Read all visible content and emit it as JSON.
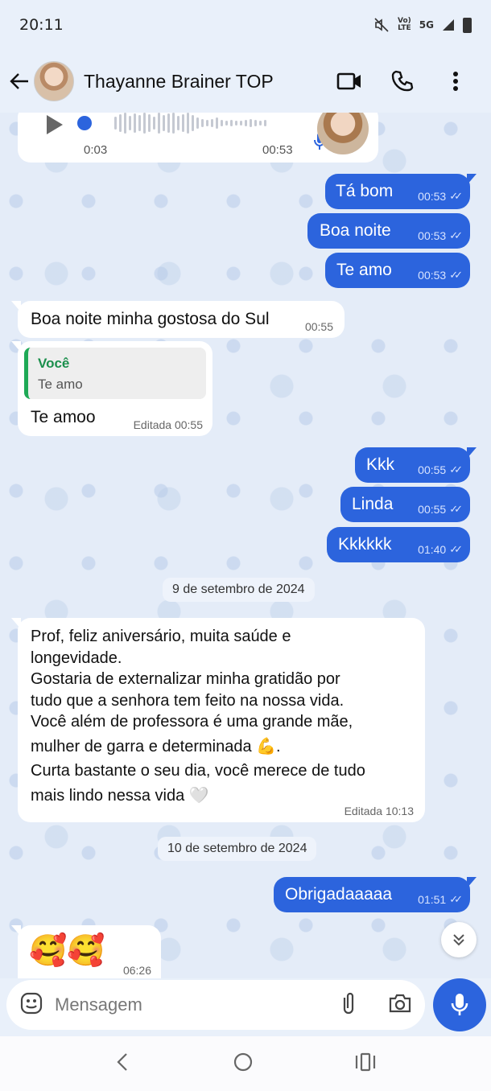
{
  "status": {
    "time": "20:11",
    "network_top": "Vo)",
    "network_bottom": "LTE",
    "signal": "5G"
  },
  "header": {
    "contact_name": "Thayanne Brainer TOP"
  },
  "audio": {
    "elapsed": "0:03",
    "time": "00:53"
  },
  "messages": [
    {
      "text": "Tá bom",
      "time": "00:53"
    },
    {
      "text": "Boa noite",
      "time": "00:53"
    },
    {
      "text": "Te amo",
      "time": "00:53"
    },
    {
      "text": "Boa noite minha gostosa do Sul",
      "time": "00:55"
    },
    {
      "reply_author": "Você",
      "reply_text": "Te amo",
      "text": "Te amoo",
      "time": "Editada 00:55"
    },
    {
      "text": "Kkk",
      "time": "00:55"
    },
    {
      "text": "Linda",
      "time": "00:55"
    },
    {
      "text": "Kkkkkk",
      "time": "01:40"
    },
    {
      "lines": [
        "Prof, feliz aniversário, muita saúde e",
        "longevidade.",
        "Gostaria de externalizar minha gratidão por",
        "tudo que a senhora tem feito na nossa vida.",
        "Você além de professora é uma grande mãe,",
        "mulher de garra e determinada 💪.",
        "Curta bastante o seu dia, você merece de tudo",
        "mais lindo nessa vida 🤍"
      ],
      "time": "Editada 10:13"
    },
    {
      "text": "Obrigadaaaaa",
      "time": "01:51"
    },
    {
      "text": "🥰🥰",
      "time": "06:26"
    }
  ],
  "dates": [
    "9 de setembro de 2024",
    "10 de setembro de 2024"
  ],
  "composer": {
    "placeholder": "Mensagem"
  },
  "icons": {
    "back": "arrow-left-icon",
    "video": "video-camera-icon",
    "call": "phone-icon",
    "more": "more-vertical-icon",
    "play": "play-icon",
    "emoji": "emoji-icon",
    "attach": "paperclip-icon",
    "camera": "camera-icon",
    "mic": "microphone-icon",
    "scroll": "chevrons-down-icon"
  },
  "colors": {
    "outgoing_bubble": "#2c64dd",
    "incoming_bubble": "#ffffff",
    "background": "#e4ecf8",
    "accent_green": "#1ea956"
  }
}
